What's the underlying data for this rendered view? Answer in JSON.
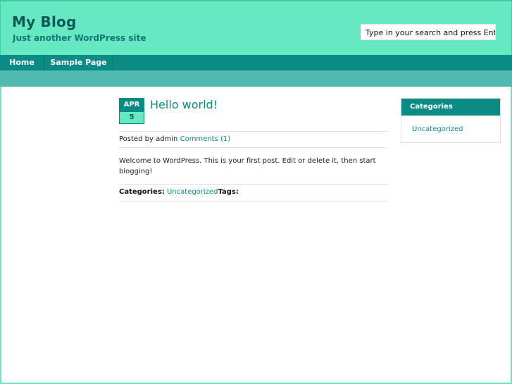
{
  "header": {
    "site_title": "My Blog",
    "site_description": "Just another WordPress site",
    "search_placeholder": "Type in your search and press Enter"
  },
  "nav": {
    "items": [
      {
        "label": "Home"
      },
      {
        "label": "Sample Page"
      }
    ]
  },
  "post": {
    "date_month": "APR",
    "date_day": "5",
    "title": "Hello world!",
    "posted_by_prefix": "Posted by",
    "author": "admin",
    "comments_link": "Comments (1)",
    "content": "Welcome to WordPress. This is your first post. Edit or delete it, then start blogging!",
    "categories_label": "Categories:",
    "category": "Uncategorized",
    "tags_label": "Tags:"
  },
  "sidebar": {
    "widget_title": "Categories",
    "items": [
      {
        "label": "Uncategorized"
      }
    ]
  },
  "colors": {
    "header_bg": "#66e8c2",
    "nav_bg": "#0a8b85",
    "subbar_bg": "#50baae",
    "link": "#0a8b85",
    "title_text": "#0b5a57"
  }
}
